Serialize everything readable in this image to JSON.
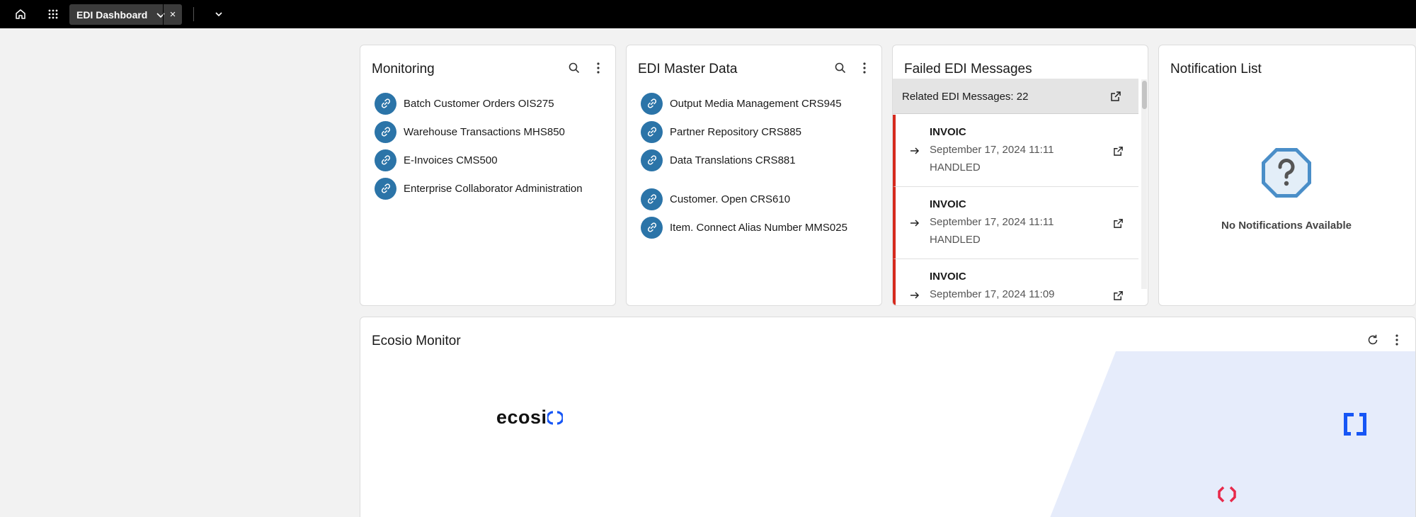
{
  "topbar": {
    "tab_label": "EDI Dashboard",
    "close_glyph": "×",
    "icons": [
      "home-icon",
      "app-grid-icon",
      "chevron-down-icon",
      "close-icon"
    ]
  },
  "monitoring": {
    "title": "Monitoring",
    "items": [
      {
        "label": "Batch Customer Orders OIS275"
      },
      {
        "label": "Warehouse Transactions MHS850"
      },
      {
        "label": "E-Invoices CMS500"
      },
      {
        "label": "Enterprise Collaborator Administration"
      }
    ]
  },
  "master_data": {
    "title": "EDI Master Data",
    "items": [
      {
        "label": "Output Media Management CRS945"
      },
      {
        "label": "Partner Repository CRS885"
      },
      {
        "label": "Data Translations CRS881"
      },
      {
        "label": "Customer. Open CRS610"
      },
      {
        "label": "Item. Connect Alias Number MMS025"
      }
    ]
  },
  "failed": {
    "title": "Failed EDI Messages",
    "related_label": "Related EDI Messages: 22",
    "messages": [
      {
        "type": "INVOIC",
        "date": "September 17, 2024 11:11",
        "status": "HANDLED"
      },
      {
        "type": "INVOIC",
        "date": "September 17, 2024 11:11",
        "status": "HANDLED"
      },
      {
        "type": "INVOIC",
        "date": "September 17, 2024 11:09",
        "status": ""
      }
    ]
  },
  "notifications": {
    "title": "Notification List",
    "empty_text": "No Notifications Available"
  },
  "ecosio": {
    "title": "Ecosio Monitor",
    "logo_text": "ecosi",
    "colors": {
      "accent_blue": "#1756f5",
      "accent_red": "#e8294a",
      "panel_bg": "#e6ecfb"
    }
  },
  "colors": {
    "link_circle": "#2b74a8",
    "failed_border": "#d62a1e",
    "topbar": "#000000"
  }
}
